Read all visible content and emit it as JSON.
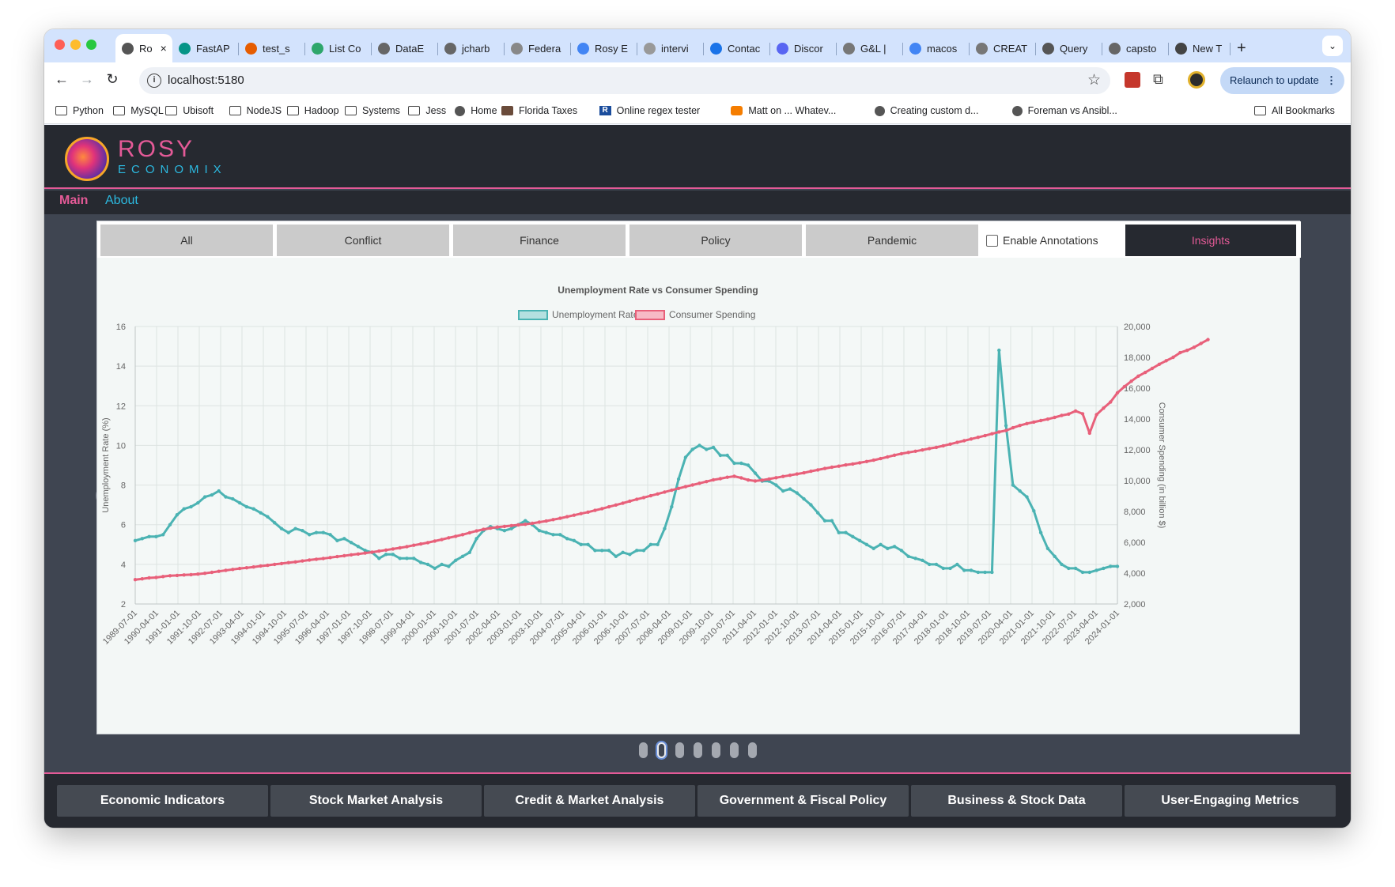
{
  "browser": {
    "tabs": [
      {
        "title": "Ro",
        "color": "#555555"
      },
      {
        "title": "FastAP",
        "color": "#059487"
      },
      {
        "title": "test_s",
        "color": "#e65c00"
      },
      {
        "title": "List Co",
        "color": "#2ea66b"
      },
      {
        "title": "DataE",
        "color": "#666666"
      },
      {
        "title": "jcharb",
        "color": "#666666"
      },
      {
        "title": "Federa",
        "color": "#888888"
      },
      {
        "title": "Rosy E",
        "color": "#4285f4"
      },
      {
        "title": "intervi",
        "color": "#999999"
      },
      {
        "title": "Contac",
        "color": "#1a73e8"
      },
      {
        "title": "Discor",
        "color": "#5865f2"
      },
      {
        "title": "G&L |",
        "color": "#777777"
      },
      {
        "title": "macos",
        "color": "#4285f4"
      },
      {
        "title": "CREAT",
        "color": "#777777"
      },
      {
        "title": "Query",
        "color": "#555555"
      },
      {
        "title": "capsto",
        "color": "#666666"
      },
      {
        "title": "New T",
        "color": "#444444"
      }
    ],
    "new_tab": "+",
    "url": "localhost:5180",
    "relaunch": "Relaunch to update",
    "bookmarks": [
      {
        "label": "Python",
        "icon": "folder"
      },
      {
        "label": "MySQL",
        "icon": "folder"
      },
      {
        "label": "Ubisoft",
        "icon": "folder"
      },
      {
        "label": "NodeJS",
        "icon": "folder"
      },
      {
        "label": "Hadoop",
        "icon": "folder"
      },
      {
        "label": "Systems",
        "icon": "folder"
      },
      {
        "label": "Jess",
        "icon": "folder"
      },
      {
        "label": "Home",
        "icon": "globe"
      },
      {
        "label": "Florida Taxes",
        "icon": "img"
      },
      {
        "label": "Online regex tester",
        "icon": "r"
      },
      {
        "label": "Matt on ... Whatev...",
        "icon": "b"
      },
      {
        "label": "Creating custom d...",
        "icon": "globe"
      },
      {
        "label": "Foreman vs Ansibl...",
        "icon": "globe"
      }
    ],
    "all_bookmarks": "All Bookmarks"
  },
  "app": {
    "logo_title": "ROSY",
    "logo_subtitle": "ECONOMIX",
    "nav": {
      "main": "Main",
      "about": "About"
    },
    "filters": [
      "All",
      "Conflict",
      "Finance",
      "Policy",
      "Pandemic"
    ],
    "annotations_label": "Enable Annotations",
    "insights": "Insights",
    "prev": "‹",
    "next": "›",
    "slide_count": 7,
    "active_slide": 1,
    "categories": [
      "Economic Indicators",
      "Stock Market Analysis",
      "Credit & Market Analysis",
      "Government & Fiscal Policy",
      "Business & Stock Data",
      "User-Engaging Metrics"
    ],
    "colors": {
      "accent_pink": "#e45a97",
      "accent_cyan": "#2cb9e0",
      "header_bg": "#262930"
    }
  },
  "chart_data": {
    "type": "line",
    "title": "Unemployment Rate vs Consumer Spending",
    "ylabel": "Unemployment Rate (%)",
    "y2label": "Consumer Spending (in billion $)",
    "ylim": [
      2,
      16
    ],
    "yticks": [
      2,
      4,
      6,
      8,
      10,
      12,
      14,
      16
    ],
    "y2lim": [
      2000,
      20000
    ],
    "y2ticks": [
      "2,000",
      "4,000",
      "6,000",
      "8,000",
      "10,000",
      "12,000",
      "14,000",
      "16,000",
      "18,000",
      "20,000"
    ],
    "xrange": [
      "1989-07-01",
      "2024-04-01"
    ],
    "xticks": [
      "1989-07-01",
      "1990-04-01",
      "1991-01-01",
      "1991-10-01",
      "1992-07-01",
      "1993-04-01",
      "1994-01-01",
      "1994-10-01",
      "1995-07-01",
      "1996-04-01",
      "1997-01-01",
      "1997-10-01",
      "1998-07-01",
      "1999-04-01",
      "2000-01-01",
      "2000-10-01",
      "2001-07-01",
      "2002-04-01",
      "2003-01-01",
      "2003-10-01",
      "2004-07-01",
      "2005-04-01",
      "2006-01-01",
      "2006-10-01",
      "2007-07-01",
      "2008-04-01",
      "2009-01-01",
      "2009-10-01",
      "2010-07-01",
      "2011-04-01",
      "2012-01-01",
      "2012-10-01",
      "2013-07-01",
      "2014-04-01",
      "2015-01-01",
      "2015-10-01",
      "2016-07-01",
      "2017-04-01",
      "2018-01-01",
      "2018-10-01",
      "2019-07-01",
      "2020-04-01",
      "2021-01-01",
      "2021-10-01",
      "2022-07-01",
      "2023-04-01",
      "2024-01-01"
    ],
    "grid": true,
    "legend": "top",
    "series": [
      {
        "name": "Unemployment Rate",
        "axis": "left",
        "color": "#4bb3b3",
        "values": [
          5.2,
          5.3,
          5.4,
          5.4,
          5.5,
          6.0,
          6.5,
          6.8,
          6.9,
          7.1,
          7.4,
          7.5,
          7.7,
          7.4,
          7.3,
          7.1,
          6.9,
          6.8,
          6.6,
          6.4,
          6.1,
          5.8,
          5.6,
          5.8,
          5.7,
          5.5,
          5.6,
          5.6,
          5.5,
          5.2,
          5.3,
          5.1,
          4.9,
          4.7,
          4.6,
          4.3,
          4.5,
          4.5,
          4.3,
          4.3,
          4.3,
          4.1,
          4.0,
          3.8,
          4.0,
          3.9,
          4.2,
          4.4,
          4.6,
          5.3,
          5.7,
          5.9,
          5.8,
          5.7,
          5.8,
          6.0,
          6.2,
          6.0,
          5.7,
          5.6,
          5.5,
          5.5,
          5.3,
          5.2,
          5.0,
          5.0,
          4.7,
          4.7,
          4.7,
          4.4,
          4.6,
          4.5,
          4.7,
          4.7,
          5.0,
          5.0,
          5.8,
          6.9,
          8.3,
          9.4,
          9.8,
          10.0,
          9.8,
          9.9,
          9.5,
          9.5,
          9.1,
          9.1,
          9.0,
          8.6,
          8.2,
          8.2,
          8.0,
          7.7,
          7.8,
          7.6,
          7.3,
          7.0,
          6.6,
          6.2,
          6.2,
          5.6,
          5.6,
          5.4,
          5.2,
          5.0,
          4.8,
          5.0,
          4.8,
          4.9,
          4.7,
          4.4,
          4.3,
          4.2,
          4.0,
          4.0,
          3.8,
          3.8,
          4.0,
          3.7,
          3.7,
          3.6,
          3.6,
          3.6,
          14.8,
          11.0,
          8.0,
          7.7,
          7.4,
          6.7,
          5.6,
          4.8,
          4.4,
          4.0,
          3.8,
          3.8,
          3.6,
          3.6,
          3.7,
          3.8,
          3.9,
          3.9
        ]
      },
      {
        "name": "Consumer Spending",
        "axis": "right",
        "color": "#e8607a",
        "values": [
          3580,
          3630,
          3690,
          3720,
          3780,
          3830,
          3850,
          3880,
          3900,
          3940,
          3990,
          4050,
          4120,
          4180,
          4240,
          4300,
          4350,
          4400,
          4460,
          4510,
          4570,
          4620,
          4680,
          4730,
          4790,
          4850,
          4900,
          4950,
          5010,
          5070,
          5130,
          5190,
          5240,
          5300,
          5360,
          5430,
          5500,
          5570,
          5640,
          5720,
          5810,
          5890,
          5980,
          6080,
          6180,
          6290,
          6390,
          6500,
          6620,
          6740,
          6840,
          6920,
          6990,
          7030,
          7080,
          7130,
          7170,
          7230,
          7310,
          7380,
          7470,
          7560,
          7660,
          7760,
          7860,
          7960,
          8070,
          8180,
          8300,
          8420,
          8540,
          8670,
          8790,
          8900,
          9020,
          9140,
          9260,
          9380,
          9500,
          9610,
          9720,
          9830,
          9940,
          10050,
          10130,
          10220,
          10280,
          10180,
          10040,
          9980,
          10030,
          10110,
          10190,
          10270,
          10350,
          10430,
          10510,
          10610,
          10700,
          10790,
          10870,
          10940,
          11020,
          11080,
          11160,
          11240,
          11330,
          11430,
          11540,
          11650,
          11750,
          11830,
          11910,
          11990,
          12080,
          12160,
          12260,
          12370,
          12480,
          12590,
          12700,
          12810,
          12920,
          13040,
          13160,
          13250,
          13430,
          13580,
          13700,
          13800,
          13900,
          13990,
          14100,
          14230,
          14320,
          14520,
          14340,
          13080,
          14280,
          14700,
          15100,
          15700,
          16100,
          16450,
          16780,
          17020,
          17280,
          17550,
          17780,
          18000,
          18300,
          18450,
          18650,
          18900,
          19150
        ]
      }
    ]
  }
}
